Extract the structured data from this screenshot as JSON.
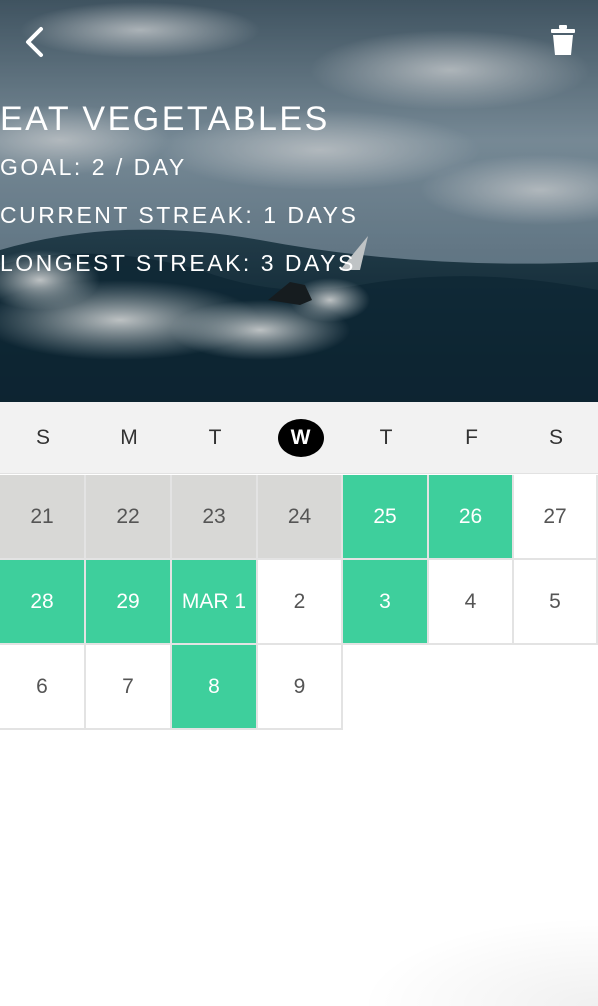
{
  "header": {
    "back_icon": "chevron-left-icon",
    "delete_icon": "trash-icon",
    "title": "EAT VEGETABLES",
    "goal": "GOAL: 2 / DAY",
    "current_streak": "CURRENT STREAK: 1 DAYS",
    "longest_streak": "LONGEST STREAK: 3 DAYS"
  },
  "weekdays": [
    "S",
    "M",
    "T",
    "W",
    "T",
    "F",
    "S"
  ],
  "today_index": 3,
  "calendar": {
    "rows": [
      [
        {
          "label": "21",
          "state": "past"
        },
        {
          "label": "22",
          "state": "past"
        },
        {
          "label": "23",
          "state": "past"
        },
        {
          "label": "24",
          "state": "past"
        },
        {
          "label": "25",
          "state": "done"
        },
        {
          "label": "26",
          "state": "done"
        },
        {
          "label": "27",
          "state": "empty"
        }
      ],
      [
        {
          "label": "28",
          "state": "done"
        },
        {
          "label": "29",
          "state": "done"
        },
        {
          "label": "MAR 1",
          "state": "done"
        },
        {
          "label": "2",
          "state": "empty"
        },
        {
          "label": "3",
          "state": "done"
        },
        {
          "label": "4",
          "state": "empty"
        },
        {
          "label": "5",
          "state": "empty"
        }
      ],
      [
        {
          "label": "6",
          "state": "empty"
        },
        {
          "label": "7",
          "state": "empty"
        },
        {
          "label": "8",
          "state": "done"
        },
        {
          "label": "9",
          "state": "empty"
        }
      ]
    ]
  },
  "colors": {
    "done": "#3ecf9c",
    "past": "#d8d8d6",
    "today_badge": "#000000"
  }
}
